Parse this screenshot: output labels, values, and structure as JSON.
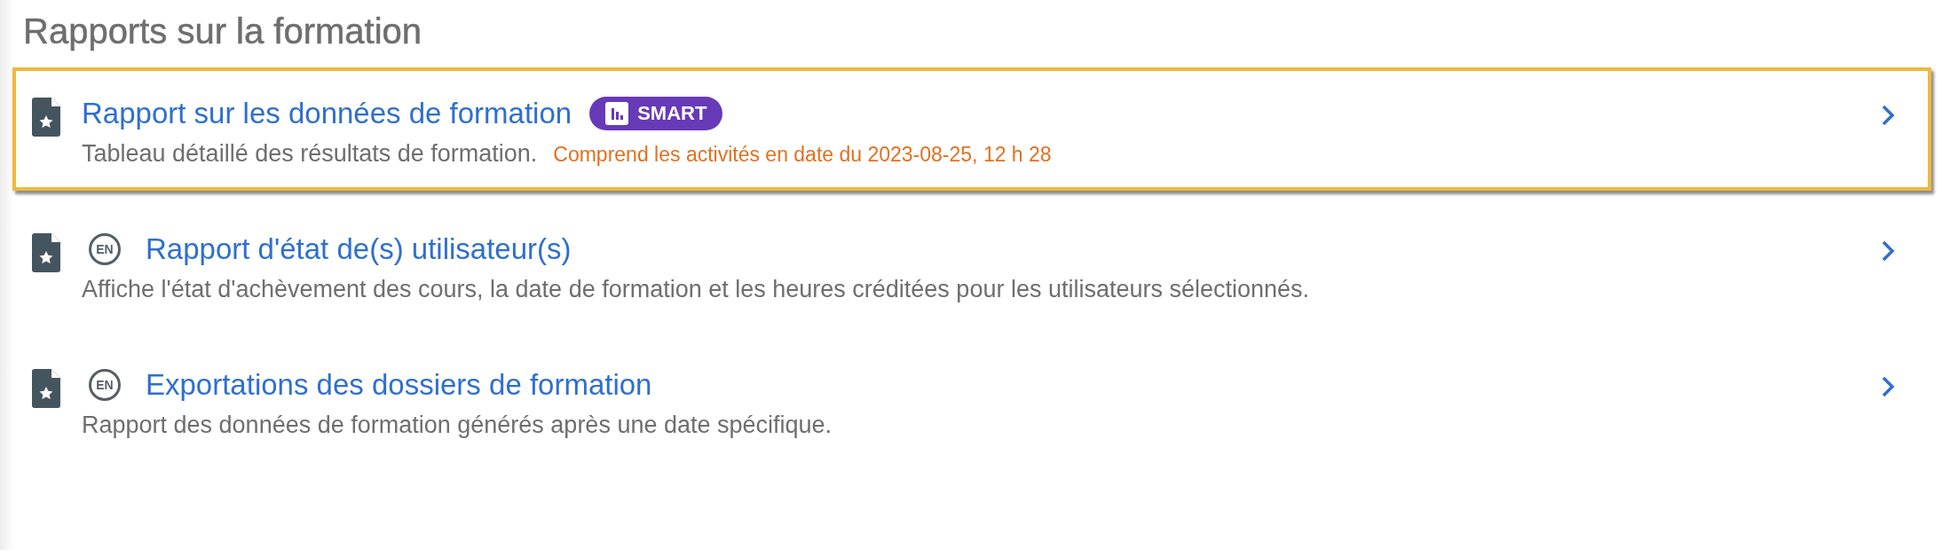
{
  "heading": "Rapports sur la formation",
  "reports": [
    {
      "title": "Rapport sur les données de formation",
      "highlighted": true,
      "badge": "SMART",
      "description": "Tableau détaillé des résultats de formation.",
      "notice": "Comprend les activités en date du 2023-08-25, 12 h 28"
    },
    {
      "title": "Rapport d'état de(s) utilisateur(s)",
      "highlighted": false,
      "language": "EN",
      "description": "Affiche l'état d'achèvement des cours, la date de formation et les heures créditées pour les utilisateurs sélectionnés."
    },
    {
      "title": "Exportations des dossiers de formation",
      "highlighted": false,
      "language": "EN",
      "description": "Rapport des données de formation générés après une date spécifique."
    }
  ]
}
